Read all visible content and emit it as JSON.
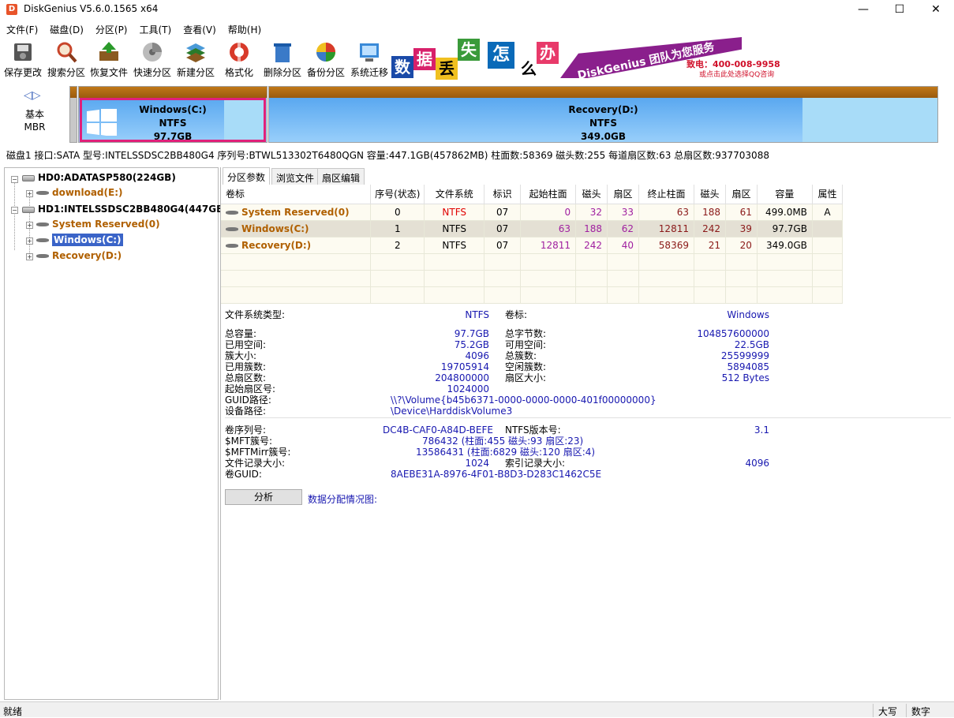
{
  "window": {
    "title": "DiskGenius V5.6.0.1565 x64",
    "icon_letter": "D",
    "min": "—",
    "max": "☐",
    "close": "✕"
  },
  "menu": [
    "文件(F)",
    "磁盘(D)",
    "分区(P)",
    "工具(T)",
    "查看(V)",
    "帮助(H)"
  ],
  "toolbar": [
    {
      "label": "保存更改",
      "icon": "save-icon"
    },
    {
      "label": "搜索分区",
      "icon": "search-icon"
    },
    {
      "label": "恢复文件",
      "icon": "restore-icon"
    },
    {
      "label": "快速分区",
      "icon": "quick-partition-icon"
    },
    {
      "label": "新建分区",
      "icon": "new-partition-icon"
    },
    {
      "label": "格式化",
      "icon": "format-icon"
    },
    {
      "label": "删除分区",
      "icon": "delete-icon"
    },
    {
      "label": "备份分区",
      "icon": "backup-icon"
    },
    {
      "label": "系统迁移",
      "icon": "migrate-icon"
    }
  ],
  "banner": {
    "chars": [
      "数",
      "据",
      "丢",
      "失",
      "怎",
      "么",
      "办"
    ],
    "slogan": "DiskGenius 团队为您服务",
    "phone": "致电：400-008-9958",
    "qq": "或点击此处选择QQ咨询"
  },
  "diskmap": {
    "type_line1": "基本",
    "type_line2": "MBR",
    "partitions": [
      {
        "name": "Windows(C:)",
        "fs": "NTFS",
        "size": "97.7GB"
      },
      {
        "name": "Recovery(D:)",
        "fs": "NTFS",
        "size": "349.0GB"
      }
    ]
  },
  "diskinfo": "磁盘1 接口:SATA  型号:INTELSSDSC2BB480G4  序列号:BTWL513302T6480QGN  容量:447.1GB(457862MB)  柱面数:58369  磁头数:255  每道扇区数:63  总扇区数:937703088",
  "tree": {
    "hd0": "HD0:ADATASP580(224GB)",
    "hd0_part": "download(E:)",
    "hd1": "HD1:INTELSSDSC2BB480G4(447GB)",
    "hd1_parts": [
      "System Reserved(0)",
      "Windows(C:)",
      "Recovery(D:)"
    ]
  },
  "tabs": [
    "分区参数",
    "浏览文件",
    "扇区编辑"
  ],
  "table": {
    "headers": [
      "卷标",
      "序号(状态)",
      "文件系统",
      "标识",
      "起始柱面",
      "磁头",
      "扇区",
      "终止柱面",
      "磁头",
      "扇区",
      "容量",
      "属性"
    ],
    "rows": [
      [
        "System Reserved(0)",
        "0",
        "NTFS",
        "07",
        "0",
        "32",
        "33",
        "63",
        "188",
        "61",
        "499.0MB",
        "A"
      ],
      [
        "Windows(C:)",
        "1",
        "NTFS",
        "07",
        "63",
        "188",
        "62",
        "12811",
        "242",
        "39",
        "97.7GB",
        ""
      ],
      [
        "Recovery(D:)",
        "2",
        "NTFS",
        "07",
        "12811",
        "242",
        "40",
        "58369",
        "21",
        "20",
        "349.0GB",
        ""
      ]
    ]
  },
  "fsinfo": {
    "fs_type_label": "文件系统类型:",
    "fs_type": "NTFS",
    "vol_label_label": "卷标:",
    "vol_label": "Windows",
    "left": [
      [
        "总容量:",
        "97.7GB"
      ],
      [
        "已用空间:",
        "75.2GB"
      ],
      [
        "簇大小:",
        "4096"
      ],
      [
        "已用簇数:",
        "19705914"
      ],
      [
        "总扇区数:",
        "204800000"
      ],
      [
        "起始扇区号:",
        "1024000"
      ]
    ],
    "right": [
      [
        "总字节数:",
        "104857600000"
      ],
      [
        "可用空间:",
        "22.5GB"
      ],
      [
        "总簇数:",
        "25599999"
      ],
      [
        "空闲簇数:",
        "5894085"
      ],
      [
        "扇区大小:",
        "512 Bytes"
      ]
    ],
    "guid_label": "GUID路径:",
    "guid": "\\\\?\\Volume{b45b6371-0000-0000-0000-401f00000000}",
    "dev_label": "设备路径:",
    "dev": "\\Device\\HarddiskVolume3",
    "serial_label": "卷序列号:",
    "serial": "DC4B-CAF0-A84D-BEFE",
    "ntfs_ver_label": "NTFS版本号:",
    "ntfs_ver": "3.1",
    "mft_label": "$MFT簇号:",
    "mft": "786432 (柱面:455 磁头:93 扇区:23)",
    "mftmirr_label": "$MFTMirr簇号:",
    "mftmirr": "13586431 (柱面:6829 磁头:120 扇区:4)",
    "rec_size_label": "文件记录大小:",
    "rec_size": "1024",
    "idx_size_label": "索引记录大小:",
    "idx_size": "4096",
    "vol_guid_label": "卷GUID:",
    "vol_guid": "8AEBE31A-8976-4F01-B8D3-D283C1462C5E"
  },
  "analyze_button": "分析",
  "chart_label": "数据分配情况图:",
  "status": {
    "text": "就绪",
    "caps": "大写",
    "num": "数字"
  },
  "colors": {
    "accent_orange": "#b06000",
    "value_blue": "#1818b0",
    "num_purple": "#a020a0",
    "fs_red": "#e00000",
    "selection": "#3a64c8"
  }
}
